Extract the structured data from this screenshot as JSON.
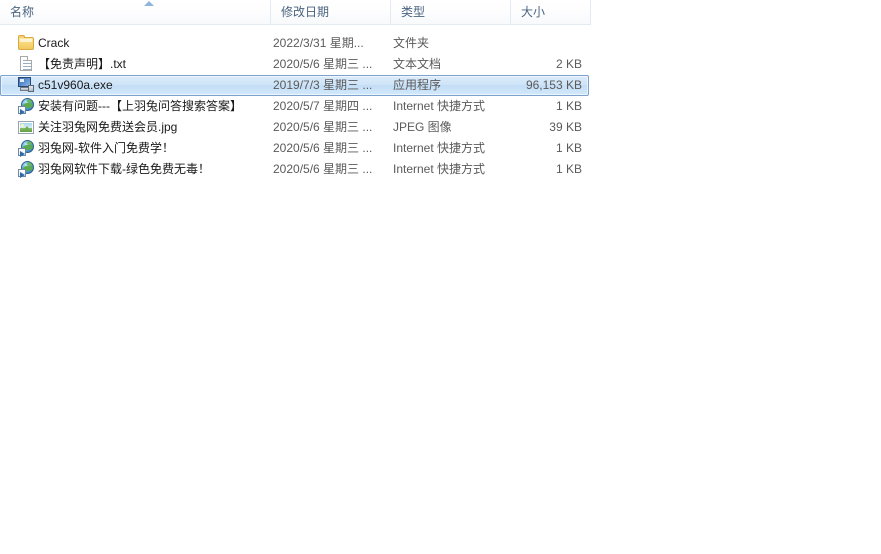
{
  "window": {
    "view": "details-list"
  },
  "columns": {
    "headers": [
      {
        "key": "name",
        "label": "名称",
        "sorted": true,
        "sort_direction": "ascending"
      },
      {
        "key": "date",
        "label": "修改日期",
        "sorted": false,
        "sort_direction": ""
      },
      {
        "key": "type",
        "label": "类型",
        "sorted": false,
        "sort_direction": ""
      },
      {
        "key": "size",
        "label": "大小",
        "sorted": false,
        "sort_direction": ""
      }
    ]
  },
  "files": [
    {
      "name": "Crack",
      "date": "2022/3/31 星期...",
      "type": "文件夹",
      "size": "",
      "icon": "folder-icon",
      "selected": false
    },
    {
      "name": "【免责声明】.txt",
      "date": "2020/5/6 星期三 ...",
      "type": "文本文档",
      "size": "2 KB",
      "icon": "text-document-icon",
      "selected": false
    },
    {
      "name": "c51v960a.exe",
      "date": "2019/7/3 星期三 ...",
      "type": "应用程序",
      "size": "96,153 KB",
      "icon": "application-icon",
      "selected": true
    },
    {
      "name": "安装有问题---【上羽兔问答搜索答案】",
      "date": "2020/5/7 星期四 ...",
      "type": "Internet 快捷方式",
      "size": "1 KB",
      "icon": "internet-shortcut-icon",
      "selected": false
    },
    {
      "name": "关注羽兔网免费送会员.jpg",
      "date": "2020/5/6 星期三 ...",
      "type": "JPEG 图像",
      "size": "39 KB",
      "icon": "image-icon",
      "selected": false
    },
    {
      "name": "羽兔网-软件入门免费学！",
      "date": "2020/5/6 星期三 ...",
      "type": "Internet 快捷方式",
      "size": "1 KB",
      "icon": "internet-shortcut-icon",
      "selected": false
    },
    {
      "name": "羽兔网软件下载-绿色免费无毒！",
      "date": "2020/5/6 星期三 ...",
      "type": "Internet 快捷方式",
      "size": "1 KB",
      "icon": "internet-shortcut-icon",
      "selected": false
    }
  ],
  "colors": {
    "selection_fill": "#cfe4f8",
    "selection_border": "#7da2ce",
    "header_text": "#4a6480",
    "detail_text": "#5a5a5a",
    "name_text": "#1a1a1a",
    "sort_arrow": "#8fb4d9"
  }
}
